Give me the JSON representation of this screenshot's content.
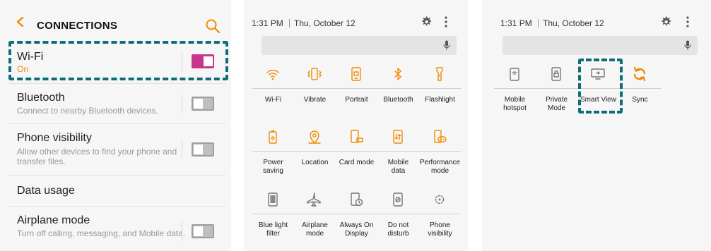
{
  "connections": {
    "title": "CONNECTIONS",
    "rows": [
      {
        "title": "Wi-Fi",
        "subtitle": "On",
        "toggle": "on"
      },
      {
        "title": "Bluetooth",
        "subtitle": "Connect to nearby Bluetooth devices.",
        "toggle": "off"
      },
      {
        "title": "Phone visibility",
        "subtitle_line1": "Allow other devices to find your phone and",
        "subtitle_line2": "transfer files.",
        "toggle": "off"
      },
      {
        "title": "Data usage"
      },
      {
        "title": "Airplane mode",
        "subtitle": "Turn off calling, messaging, and Mobile data.",
        "toggle": "off"
      }
    ]
  },
  "quick_panel_a": {
    "time": "1:31 PM",
    "date": "Thu, October 12",
    "tiles": [
      {
        "l1": "Wi-Fi",
        "l2": "",
        "icon": "wifi-icon"
      },
      {
        "l1": "Vibrate",
        "l2": "",
        "icon": "vibrate-icon"
      },
      {
        "l1": "Portrait",
        "l2": "",
        "icon": "portrait-icon"
      },
      {
        "l1": "Bluetooth",
        "l2": "",
        "icon": "bluetooth-icon"
      },
      {
        "l1": "Flashlight",
        "l2": "",
        "icon": "flashlight-icon"
      },
      {
        "l1": "Power",
        "l2": "saving",
        "icon": "power-saving-icon"
      },
      {
        "l1": "Location",
        "l2": "",
        "icon": "location-icon"
      },
      {
        "l1": "Card mode",
        "l2": "",
        "icon": "card-mode-icon"
      },
      {
        "l1": "Mobile",
        "l2": "data",
        "icon": "mobile-data-icon"
      },
      {
        "l1": "Performance",
        "l2": "mode",
        "icon": "performance-mode-icon"
      },
      {
        "l1": "Blue light",
        "l2": "filter",
        "icon": "blue-light-filter-icon"
      },
      {
        "l1": "Airplane",
        "l2": "mode",
        "icon": "airplane-icon"
      },
      {
        "l1": "Always On",
        "l2": "Display",
        "icon": "always-on-display-icon"
      },
      {
        "l1": "Do not",
        "l2": "disturb",
        "icon": "do-not-disturb-icon"
      },
      {
        "l1": "Phone",
        "l2": "visibility",
        "icon": "phone-visibility-icon"
      }
    ]
  },
  "quick_panel_b": {
    "time": "1:31 PM",
    "date": "Thu, October 12",
    "tiles": [
      {
        "l1": "Mobile",
        "l2": "hotspot",
        "icon": "mobile-hotspot-icon"
      },
      {
        "l1": "Private",
        "l2": "Mode",
        "icon": "private-mode-icon"
      },
      {
        "l1": "Smart View",
        "l2": "",
        "icon": "smart-view-icon"
      },
      {
        "l1": "Sync",
        "l2": "",
        "icon": "sync-icon"
      }
    ]
  },
  "colors": {
    "accent_orange": "#f08a00",
    "toggle_on": "#c8368c",
    "highlight": "#0e6e78"
  }
}
